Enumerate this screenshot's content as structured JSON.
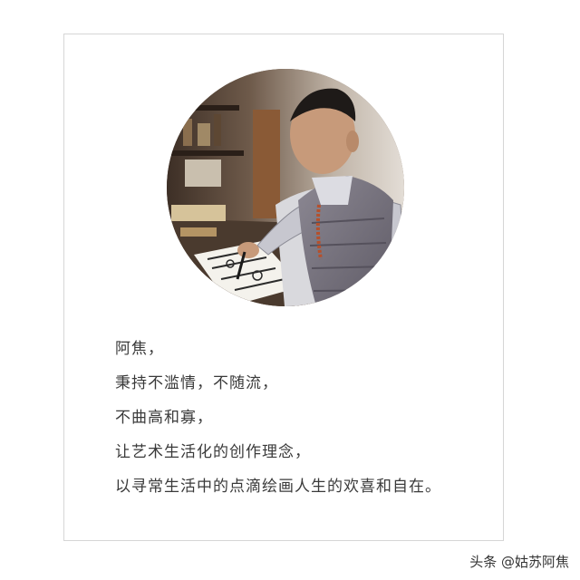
{
  "poem": {
    "lines": [
      "阿焦，",
      "秉持不滥情，不随流，",
      "不曲高和寡，",
      "让艺术生活化的创作理念，",
      "以寻常生活中的点滴绘画人生的欢喜和自在。"
    ]
  },
  "watermark": {
    "text": "头条 @姑苏阿焦"
  },
  "colors": {
    "text": "#3a3a3a",
    "card_border": "#d6d6d6",
    "vest": "#7f7b86",
    "background_wood": "#6b5646"
  }
}
